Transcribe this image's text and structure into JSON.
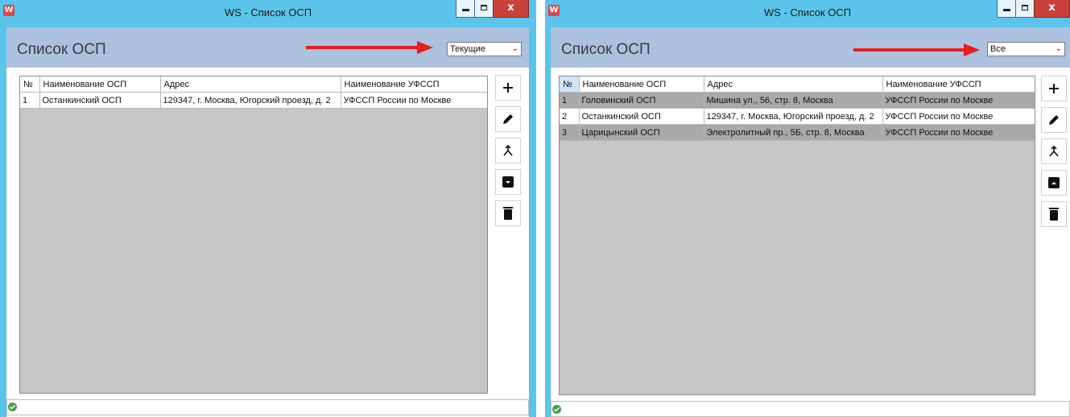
{
  "windows": [
    {
      "title": "WS - Список ОСП",
      "window_buttons": {
        "minimize": "_",
        "maximize": "□",
        "close": "x"
      },
      "page_title": "Список ОСП",
      "filter": {
        "selected": "Текущие",
        "icon": "chevron-down-icon"
      },
      "columns": [
        "№",
        "Наименование ОСП",
        "Адрес",
        "Наименование УФССП"
      ],
      "rows": [
        {
          "num": "1",
          "name": "Останкинский ОСП",
          "address": "129347, г. Москва, Югорский проезд, д. 2",
          "ufssp": "УФССП России по Москве"
        }
      ],
      "toolbar": [
        "add-icon",
        "edit-icon",
        "merge-icon",
        "archive-icon",
        "delete-icon"
      ],
      "status_icon": "ok-check-icon",
      "accent": "#5bc4ea",
      "header_bg": "#abc1dd",
      "arrow_color": "#e81c1c"
    },
    {
      "title": "WS - Список ОСП",
      "window_buttons": {
        "minimize": "_",
        "maximize": "□",
        "close": "x"
      },
      "page_title": "Список ОСП",
      "filter": {
        "selected": "Все",
        "icon": "chevron-down-icon"
      },
      "columns": [
        "№",
        "Наименование ОСП",
        "Адрес",
        "Наименование УФССП"
      ],
      "rows": [
        {
          "num": "1",
          "name": "Головинский ОСП",
          "address": "Мишина ул., 56, стр. 8, Москва",
          "ufssp": "УФССП России по Москве"
        },
        {
          "num": "2",
          "name": "Останкинский ОСП",
          "address": "129347, г. Москва, Югорский проезд, д. 2",
          "ufssp": "УФССП России по Москве"
        },
        {
          "num": "3",
          "name": "Царицынский ОСП",
          "address": "Электролитный пр., 5Б, стр. 8, Москва",
          "ufssp": "УФССП России по Москве"
        }
      ],
      "toolbar": [
        "add-icon",
        "edit-icon",
        "merge-icon",
        "unarchive-icon",
        "delete-icon"
      ],
      "status_icon": "ok-check-icon",
      "accent": "#5bc4ea",
      "header_bg": "#abc1dd",
      "arrow_color": "#e81c1c"
    }
  ]
}
